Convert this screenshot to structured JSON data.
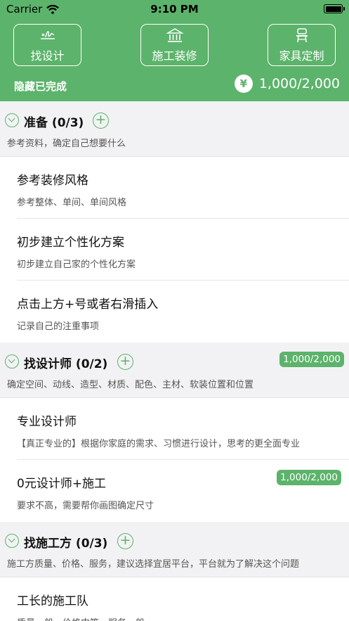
{
  "status_bar": {
    "carrier": "Carrier",
    "time": "9:10 PM"
  },
  "header": {
    "buttons": [
      {
        "label": "找设计",
        "icon": "signature-icon"
      },
      {
        "label": "施工装修",
        "icon": "building-icon"
      },
      {
        "label": "家具定制",
        "icon": "chair-icon"
      }
    ],
    "hide_completed": "隐藏已完成",
    "currency_symbol": "¥",
    "budget": "1,000/2,000"
  },
  "sections": [
    {
      "title": "准备 (0/3)",
      "description": "参考资料，确定自己想要什么",
      "badge": "",
      "items": [
        {
          "title": "参考装修风格",
          "description": "参考整体、单间、单间风格",
          "badge": ""
        },
        {
          "title": "初步建立个性化方案",
          "description": "初步建立自己家的个性化方案",
          "badge": ""
        },
        {
          "title": "点击上方+号或者右滑插入",
          "description": "记录自己的注重事项",
          "badge": ""
        }
      ]
    },
    {
      "title": "找设计师 (0/2)",
      "description": "确定空间、动线、造型、材质、配色、主材、软装位置和位置",
      "badge": "1,000/2,000",
      "items": [
        {
          "title": "专业设计师",
          "description": "【真正专业的】根据你家庭的需求、习惯进行设计，思考的更全面专业",
          "badge": ""
        },
        {
          "title": "0元设计师+施工",
          "description": "要求不高，需要帮你画图确定尺寸",
          "badge": "1,000/2,000"
        }
      ]
    },
    {
      "title": "找施工方 (0/3)",
      "description": "施工方质量、价格、服务，建议选择宜居平台，平台就为了解决这个问题",
      "badge": "",
      "items": [
        {
          "title": "工长的施工队",
          "description": "质量一般、价格中等、服务一般",
          "badge": ""
        }
      ]
    }
  ],
  "colors": {
    "accent": "#5cb36b",
    "background": "#f2f2f4"
  }
}
